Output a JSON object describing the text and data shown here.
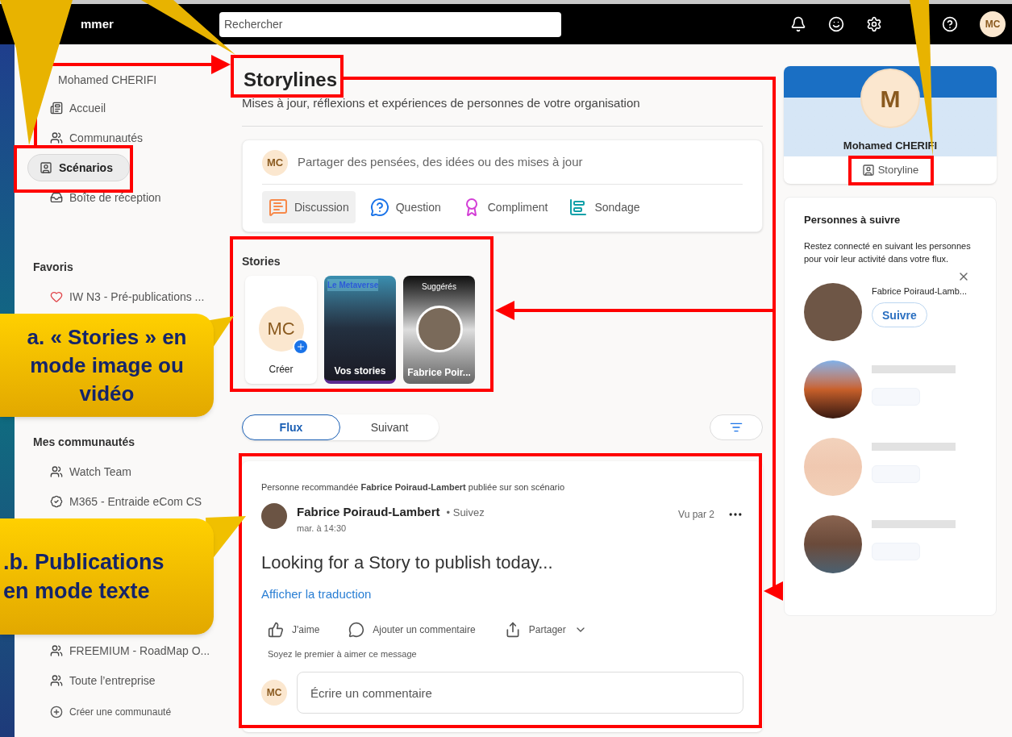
{
  "topbar": {
    "brand": "mmer",
    "search": {
      "placeholder": "Rechercher"
    },
    "avatar": "MC"
  },
  "sidebar": {
    "profile": "Mohamed CHERIFI",
    "nav": [
      {
        "label": "Accueil",
        "kind": "home",
        "selected": false
      },
      {
        "label": "Communautés",
        "kind": "community",
        "selected": false
      },
      {
        "label": "Scénarios",
        "kind": "storyline",
        "selected": true
      },
      {
        "label": "Boîte de réception",
        "kind": "inbox",
        "selected": false
      }
    ],
    "favorites": {
      "title": "Favoris",
      "items": [
        "IW N3 - Pré-publications ..."
      ]
    },
    "communities": {
      "title": "Mes communautés",
      "items": [
        {
          "label": "Watch Team",
          "kind": "community"
        },
        {
          "label": "M365 - Entraide eCom CS",
          "kind": "verified"
        },
        {
          "label": "FREEMIUM - RoadMap O...",
          "kind": "community"
        },
        {
          "label": "Toute l’entreprise",
          "kind": "community"
        }
      ],
      "create": "Créer une communauté"
    }
  },
  "main": {
    "title": "Storylines",
    "subtitle": "Mises à jour, réflexions et expériences de personnes de votre organisation",
    "composer": {
      "avatar": "MC",
      "placeholder": "Partager des pensées, des idées ou des mises à jour",
      "types": [
        {
          "label": "Discussion",
          "kind": "discussion",
          "selected": true
        },
        {
          "label": "Question",
          "kind": "question",
          "selected": false
        },
        {
          "label": "Compliment",
          "kind": "praise",
          "selected": false
        },
        {
          "label": "Sondage",
          "kind": "poll",
          "selected": false
        }
      ]
    },
    "stories": {
      "title": "Stories",
      "items": [
        {
          "kind": "create",
          "avatar": "MC",
          "label": "Créer"
        },
        {
          "kind": "own",
          "overlay": "Le Metaverse",
          "label": "Vos stories"
        },
        {
          "kind": "suggested",
          "badge": "Suggérés",
          "label": "Fabrice Poir..."
        }
      ]
    },
    "feed_tabs": [
      {
        "label": "Flux",
        "selected": true
      },
      {
        "label": "Suivant",
        "selected": false
      }
    ],
    "post": {
      "context": "Personne recommandée **Fabrice Poiraud-Lambert** publiée sur son scénario",
      "author": "Fabrice Poiraud-Lambert",
      "follow": "• Suivez",
      "time": "mar. à 14:30",
      "views": "Vu par 2",
      "body": "Looking for a Story to publish today...",
      "translate": "Afficher la traduction",
      "actions": [
        {
          "label": "J'aime",
          "kind": "like"
        },
        {
          "label": "Ajouter un commentaire",
          "kind": "comment"
        },
        {
          "label": "Partager",
          "kind": "share"
        }
      ],
      "likes": "Soyez le premier à aimer ce message",
      "comment": {
        "avatar": "MC",
        "placeholder": "Écrire un commentaire"
      }
    }
  },
  "right": {
    "profile": {
      "avatar": "M",
      "name": "Mohamed CHERIFI",
      "storyline": "Storyline"
    },
    "people": {
      "title": "Personnes à suivre",
      "description": "Restez connecté en suivant les personnes pour voir leur activité dans votre flux.",
      "first": {
        "name": "Fabrice Poiraud-Lamb...",
        "button": "Suivre"
      }
    }
  },
  "annotations": [
    {
      "text": "a. « Stories » en mode image ou vidéo"
    },
    {
      "text": ".b. Publications en mode texte"
    }
  ]
}
